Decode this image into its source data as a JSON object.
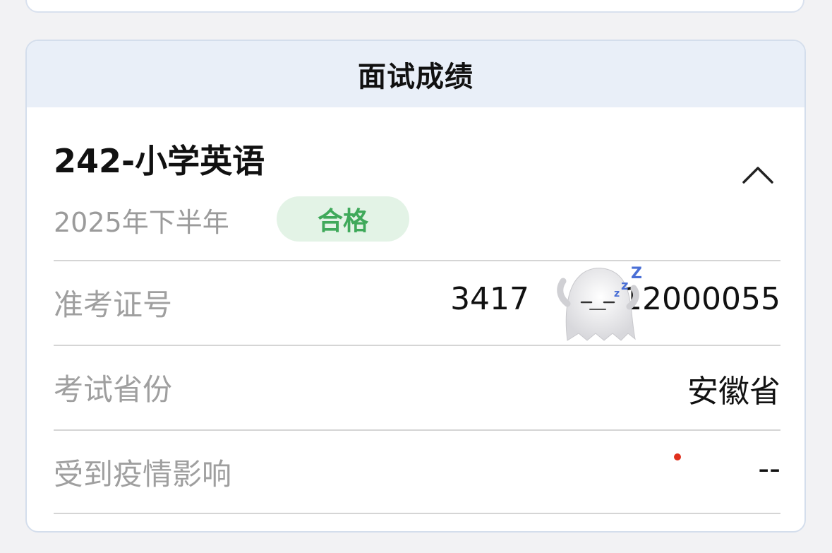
{
  "card": {
    "title": "面试成绩"
  },
  "subject": {
    "name": "242-小学英语",
    "period": "2025年下半年",
    "status": "合格",
    "status_color": "#3fa95a",
    "collapse_icon": "chevron-up-icon"
  },
  "rows": [
    {
      "label": "准考证号",
      "value": "3417   12000055"
    },
    {
      "label": "考试省份",
      "value": "安徽省"
    },
    {
      "label": "受到疫情影响",
      "value": "--"
    }
  ],
  "overlay": {
    "sticker": "sleeping-ghost-sticker"
  }
}
